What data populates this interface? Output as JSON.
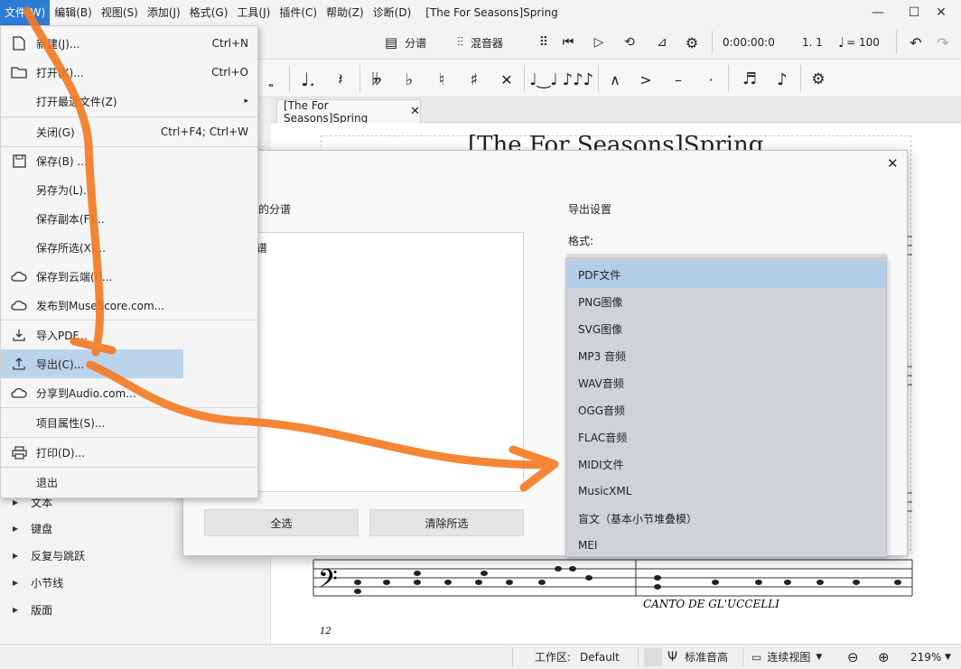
{
  "menubar": {
    "items": [
      "文件(W)",
      "编辑(B)",
      "视图(S)",
      "添加(J)",
      "格式(G)",
      "工具(J)",
      "插件(C)",
      "帮助(Z)",
      "诊断(D)"
    ],
    "title": "[The For Seasons]Spring"
  },
  "toolbar1": {
    "parts": "分谱",
    "mixer": "混音器",
    "time": "0:00:00:0",
    "measure": "1. 1",
    "tempo": "= 100"
  },
  "doc_tab": {
    "label": "[The For Seasons]Spring"
  },
  "score": {
    "title": "[The For Seasons]Spring",
    "annotation": "CANTO DE GL'UCCELLI",
    "measure_num": "12"
  },
  "file_menu": {
    "items": [
      {
        "label": "新建(J)...",
        "shortcut": "Ctrl+N",
        "icon": "new-file-icon"
      },
      {
        "label": "打开(K)...",
        "shortcut": "Ctrl+O",
        "icon": "folder-icon"
      },
      {
        "label": "打开最近文件(Z)",
        "shortcut": "▸",
        "icon": ""
      },
      {
        "label": "关闭(G)",
        "shortcut": "Ctrl+F4; Ctrl+W",
        "icon": ""
      },
      {
        "label": "保存(B) ...",
        "shortcut": "",
        "icon": "save-icon"
      },
      {
        "label": "另存为(L)...",
        "shortcut": "",
        "icon": ""
      },
      {
        "label": "保存副本(F)...",
        "shortcut": "",
        "icon": ""
      },
      {
        "label": "保存所选(X)...",
        "shortcut": "",
        "icon": ""
      },
      {
        "label": "保存到云端(I)...",
        "shortcut": "",
        "icon": "cloud-icon"
      },
      {
        "label": "发布到MuseScore.com...",
        "shortcut": "",
        "icon": "cloud-upload-icon"
      },
      {
        "label": "导入PDF...",
        "shortcut": "",
        "icon": "import-icon"
      },
      {
        "label": "导出(C)...",
        "shortcut": "",
        "icon": "export-icon"
      },
      {
        "label": "分享到Audio.com...",
        "shortcut": "",
        "icon": "share-cloud-icon"
      },
      {
        "label": "项目属性(S)...",
        "shortcut": "",
        "icon": ""
      },
      {
        "label": "打印(D)...",
        "shortcut": "",
        "icon": "print-icon"
      },
      {
        "label": "退出",
        "shortcut": "",
        "icon": ""
      }
    ]
  },
  "left_panel": {
    "items": [
      "文本",
      "键盘",
      "反复与跳跃",
      "小节线",
      "版面"
    ]
  },
  "dialog": {
    "title": "导出",
    "parts_label": "选择要导出的分谱",
    "settings_label": "导出设置",
    "format_label": "格式:",
    "parts": [
      {
        "name": "主乐谱",
        "checked": true
      },
      {
        "name": "竖琴",
        "checked": false
      }
    ],
    "select_all": "全选",
    "clear_all": "清除所选",
    "formats": [
      "PDF文件",
      "PNG图像",
      "SVG图像",
      "MP3 音频",
      "WAV音频",
      "OGG音频",
      "FLAC音频",
      "MIDI文件",
      "MusicXML",
      "盲文（基本小节堆叠模）",
      "MEI"
    ],
    "selected_format": "PDF文件"
  },
  "statusbar": {
    "workspace_label": "工作区:",
    "workspace": "Default",
    "concert_pitch": "标准音高",
    "view_mode": "连续视图",
    "zoom": "219%"
  },
  "colors": {
    "accent": "#2e7bd6",
    "highlight": "#bcd3ec",
    "annotation": "#f47920"
  }
}
